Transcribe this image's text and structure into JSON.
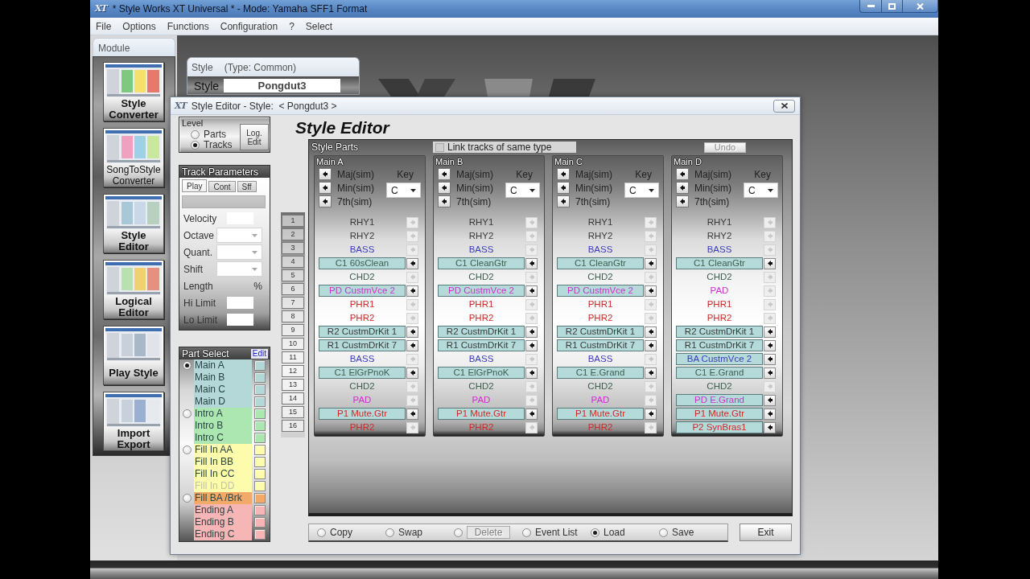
{
  "window": {
    "app_icon": "XT",
    "title": "* Style Works XT Universal * - Mode: Yamaha SFF1 Format"
  },
  "menu": [
    "File",
    "Options",
    "Functions",
    "Configuration",
    "?",
    "Select"
  ],
  "modules": {
    "title": "Module",
    "items": [
      {
        "label": "Style Converter",
        "bold": true
      },
      {
        "label": "SongToStyle Converter",
        "bold": false
      },
      {
        "label": "Style Editor",
        "bold": true
      },
      {
        "label": "Logical Editor",
        "bold": true
      },
      {
        "label": "Play Style",
        "bold": true
      },
      {
        "label": "Import Export",
        "bold": true
      }
    ]
  },
  "style_box": {
    "heading": "Style",
    "type": "(Type: Common)",
    "label": "Style",
    "value": "Pongdut3"
  },
  "dialog": {
    "app_icon": "XT",
    "title": "Style Editor - Style:  < Pongdut3 >",
    "heading": "Style Editor"
  },
  "level": {
    "title": "Level",
    "options": [
      {
        "label": "Parts",
        "selected": false
      },
      {
        "label": "Tracks",
        "selected": true
      }
    ],
    "button": "Log. Edit"
  },
  "track_parameters": {
    "title": "Track Parameters",
    "tabs": [
      {
        "label": "Play",
        "selected": true
      },
      {
        "label": "Cont",
        "selected": false
      },
      {
        "label": "Sff",
        "selected": false
      }
    ],
    "fields": [
      {
        "label": "Velocity",
        "kind": "input"
      },
      {
        "label": "Octave",
        "kind": "select"
      },
      {
        "label": "Quant.",
        "kind": "select"
      },
      {
        "label": "Shift",
        "kind": "select"
      },
      {
        "label": "Length",
        "kind": "unit",
        "unit": "%"
      },
      {
        "label": "Hi Limit",
        "kind": "input"
      },
      {
        "label": "Lo Limit",
        "kind": "input"
      }
    ]
  },
  "part_select": {
    "title": "Part Select",
    "edit": "Edit",
    "groups": [
      {
        "selected": true,
        "color": "#b4d8d8",
        "items": [
          {
            "label": "Main A",
            "disabled": false
          },
          {
            "label": "Main B",
            "disabled": false
          },
          {
            "label": "Main C",
            "disabled": false
          },
          {
            "label": "Main D",
            "disabled": false
          }
        ]
      },
      {
        "selected": false,
        "color": "#ace6b0",
        "items": [
          {
            "label": "Intro A",
            "disabled": false
          },
          {
            "label": "Intro B",
            "disabled": false
          },
          {
            "label": "Intro C",
            "disabled": false
          }
        ]
      },
      {
        "selected": false,
        "color": "#fdfcac",
        "items": [
          {
            "label": "Fill In AA",
            "disabled": false
          },
          {
            "label": "Fill In BB",
            "disabled": false
          },
          {
            "label": "Fill In CC",
            "disabled": false
          },
          {
            "label": "Fill In DD",
            "disabled": true
          }
        ]
      },
      {
        "selected": false,
        "color": "#f3aa68",
        "items": [
          {
            "label": "Fill BA /Brk",
            "disabled": false
          }
        ]
      },
      {
        "color": "#f7b6b6",
        "items": [
          {
            "label": "Ending A",
            "disabled": false
          },
          {
            "label": "Ending B",
            "disabled": false
          },
          {
            "label": "Ending C",
            "disabled": false
          }
        ]
      }
    ]
  },
  "track_numbers": [
    "1",
    "2",
    "3",
    "4",
    "5",
    "6",
    "7",
    "8",
    "9",
    "10",
    "11",
    "12",
    "13",
    "14",
    "15",
    "16"
  ],
  "style_parts": {
    "title": "Style Parts",
    "link_tracks": {
      "label": "Link tracks of same type",
      "checked": false
    },
    "undo": {
      "label": "Undo",
      "disabled": true
    },
    "columns": [
      {
        "name": "Main A",
        "chords": [
          "Maj(sim)",
          "Min(sim)",
          "7th(sim)"
        ],
        "key_label": "Key",
        "key": "C",
        "tracks": [
          {
            "label": "RHY1",
            "color": "#3a3a3a",
            "assigned": false
          },
          {
            "label": "RHY2",
            "color": "#3a3a3a",
            "assigned": false
          },
          {
            "label": "BASS",
            "color": "#3b3bbf",
            "assigned": false
          },
          {
            "label": "C1 60sClean",
            "color": "#3f5f4f",
            "assigned": true
          },
          {
            "label": "CHD2",
            "color": "#3f5f4f",
            "assigned": false
          },
          {
            "label": "PD CustmVce 2",
            "color": "#cc33cc",
            "assigned": true
          },
          {
            "label": "PHR1",
            "color": "#cc2b2b",
            "assigned": false
          },
          {
            "label": "PHR2",
            "color": "#cc2b2b",
            "assigned": false
          },
          {
            "label": "R2 CustmDrKit 1",
            "color": "#3a3a3a",
            "assigned": true
          },
          {
            "label": "R1 CustmDrKit 7",
            "color": "#3a3a3a",
            "assigned": true
          },
          {
            "label": "BASS",
            "color": "#3b3bbf",
            "assigned": false
          },
          {
            "label": "C1 ElGrPnoK",
            "color": "#3f5f4f",
            "assigned": true
          },
          {
            "label": "CHD2",
            "color": "#3f5f4f",
            "assigned": false
          },
          {
            "label": "PAD",
            "color": "#cc33cc",
            "assigned": false
          },
          {
            "label": "P1 Mute.Gtr",
            "color": "#cc2b2b",
            "assigned": true
          },
          {
            "label": "PHR2",
            "color": "#cc2b2b",
            "assigned": false
          }
        ]
      },
      {
        "name": "Main B",
        "chords": [
          "Maj(sim)",
          "Min(sim)",
          "7th(sim)"
        ],
        "key_label": "Key",
        "key": "C",
        "tracks": [
          {
            "label": "RHY1",
            "color": "#3a3a3a",
            "assigned": false
          },
          {
            "label": "RHY2",
            "color": "#3a3a3a",
            "assigned": false
          },
          {
            "label": "BASS",
            "color": "#3b3bbf",
            "assigned": false
          },
          {
            "label": "C1 CleanGtr",
            "color": "#3f5f4f",
            "assigned": true
          },
          {
            "label": "CHD2",
            "color": "#3f5f4f",
            "assigned": false
          },
          {
            "label": "PD CustmVce 2",
            "color": "#cc33cc",
            "assigned": true
          },
          {
            "label": "PHR1",
            "color": "#cc2b2b",
            "assigned": false
          },
          {
            "label": "PHR2",
            "color": "#cc2b2b",
            "assigned": false
          },
          {
            "label": "R2 CustmDrKit 1",
            "color": "#3a3a3a",
            "assigned": true
          },
          {
            "label": "R1 CustmDrKit 7",
            "color": "#3a3a3a",
            "assigned": true
          },
          {
            "label": "BASS",
            "color": "#3b3bbf",
            "assigned": false
          },
          {
            "label": "C1 ElGrPnoK",
            "color": "#3f5f4f",
            "assigned": true
          },
          {
            "label": "CHD2",
            "color": "#3f5f4f",
            "assigned": false
          },
          {
            "label": "PAD",
            "color": "#cc33cc",
            "assigned": false
          },
          {
            "label": "P1 Mute.Gtr",
            "color": "#cc2b2b",
            "assigned": true
          },
          {
            "label": "PHR2",
            "color": "#cc2b2b",
            "assigned": false
          }
        ]
      },
      {
        "name": "Main C",
        "chords": [
          "Maj(sim)",
          "Min(sim)",
          "7th(sim)"
        ],
        "key_label": "Key",
        "key": "C",
        "tracks": [
          {
            "label": "RHY1",
            "color": "#3a3a3a",
            "assigned": false
          },
          {
            "label": "RHY2",
            "color": "#3a3a3a",
            "assigned": false
          },
          {
            "label": "BASS",
            "color": "#3b3bbf",
            "assigned": false
          },
          {
            "label": "C1 CleanGtr",
            "color": "#3f5f4f",
            "assigned": true
          },
          {
            "label": "CHD2",
            "color": "#3f5f4f",
            "assigned": false
          },
          {
            "label": "PD CustmVce 2",
            "color": "#cc33cc",
            "assigned": true
          },
          {
            "label": "PHR1",
            "color": "#cc2b2b",
            "assigned": false
          },
          {
            "label": "PHR2",
            "color": "#cc2b2b",
            "assigned": false
          },
          {
            "label": "R2 CustmDrKit 1",
            "color": "#3a3a3a",
            "assigned": true
          },
          {
            "label": "R1 CustmDrKit 7",
            "color": "#3a3a3a",
            "assigned": true
          },
          {
            "label": "BASS",
            "color": "#3b3bbf",
            "assigned": false
          },
          {
            "label": "C1 E.Grand",
            "color": "#3f5f4f",
            "assigned": true
          },
          {
            "label": "CHD2",
            "color": "#3f5f4f",
            "assigned": false
          },
          {
            "label": "PAD",
            "color": "#cc33cc",
            "assigned": false
          },
          {
            "label": "P1 Mute.Gtr",
            "color": "#cc2b2b",
            "assigned": true
          },
          {
            "label": "PHR2",
            "color": "#cc2b2b",
            "assigned": false
          }
        ]
      },
      {
        "name": "Main D",
        "chords": [
          "Maj(sim)",
          "Min(sim)",
          "7th(sim)"
        ],
        "key_label": "Key",
        "key": "C",
        "tracks": [
          {
            "label": "RHY1",
            "color": "#3a3a3a",
            "assigned": false
          },
          {
            "label": "RHY2",
            "color": "#3a3a3a",
            "assigned": false
          },
          {
            "label": "BASS",
            "color": "#3b3bbf",
            "assigned": false
          },
          {
            "label": "C1 CleanGtr",
            "color": "#3f5f4f",
            "assigned": true
          },
          {
            "label": "CHD2",
            "color": "#3f5f4f",
            "assigned": false
          },
          {
            "label": "PAD",
            "color": "#cc33cc",
            "assigned": false
          },
          {
            "label": "PHR1",
            "color": "#cc2b2b",
            "assigned": false
          },
          {
            "label": "PHR2",
            "color": "#cc2b2b",
            "assigned": false
          },
          {
            "label": "R2 CustmDrKit 1",
            "color": "#3a3a3a",
            "assigned": true
          },
          {
            "label": "R1 CustmDrKit 7",
            "color": "#3a3a3a",
            "assigned": true
          },
          {
            "label": "BA CustmVce 2",
            "color": "#3b3bbf",
            "assigned": true
          },
          {
            "label": "C1 E.Grand",
            "color": "#3f5f4f",
            "assigned": true
          },
          {
            "label": "CHD2",
            "color": "#3f5f4f",
            "assigned": false
          },
          {
            "label": "PD E.Grand",
            "color": "#cc33cc",
            "assigned": true
          },
          {
            "label": "P1 Mute.Gtr",
            "color": "#cc2b2b",
            "assigned": true
          },
          {
            "label": "P2 SynBras1",
            "color": "#cc2b2b",
            "assigned": true
          }
        ]
      }
    ]
  },
  "bottom_bar": {
    "options": [
      {
        "label": "Copy",
        "kind": "label",
        "selected": false,
        "disabled": false
      },
      {
        "label": "Swap",
        "kind": "label",
        "selected": false,
        "disabled": false
      },
      {
        "label": "Delete",
        "kind": "button",
        "selected": false,
        "disabled": true
      },
      {
        "label": "Event List",
        "kind": "label",
        "selected": false,
        "disabled": false
      },
      {
        "label": "Load",
        "kind": "label",
        "selected": true,
        "disabled": false
      },
      {
        "label": "Save",
        "kind": "label",
        "selected": false,
        "disabled": false
      }
    ],
    "exit": "Exit"
  }
}
